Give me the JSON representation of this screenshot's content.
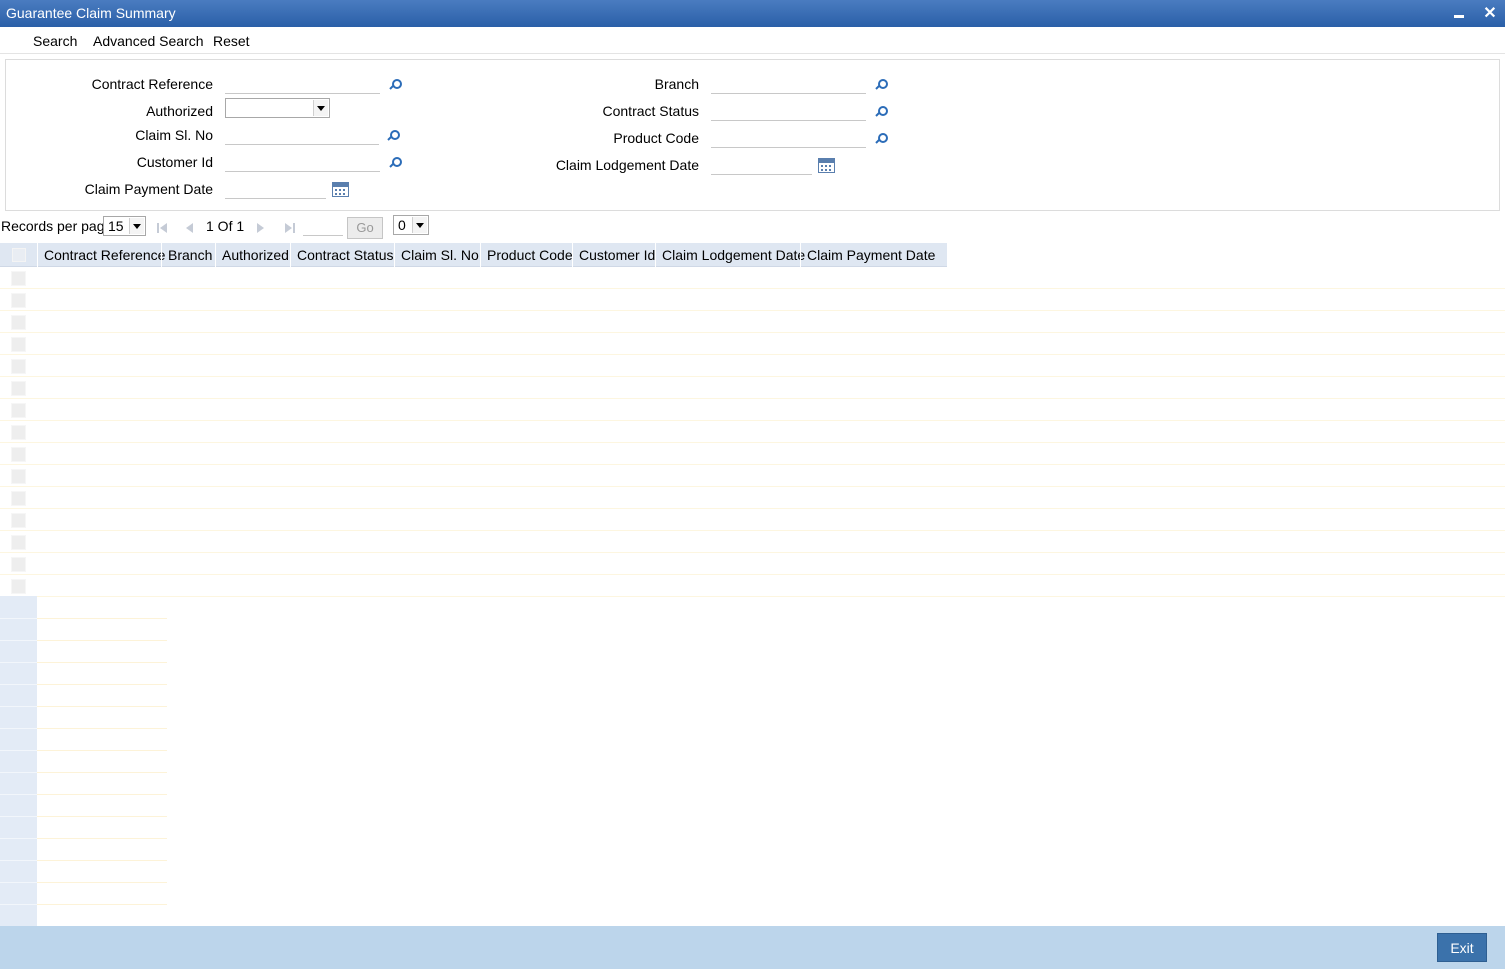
{
  "window": {
    "title": "Guarantee Claim Summary"
  },
  "toolbar": {
    "search": "Search",
    "advanced_search": "Advanced Search",
    "reset": "Reset"
  },
  "form": {
    "contract_reference": {
      "label": "Contract Reference",
      "value": ""
    },
    "authorized": {
      "label": "Authorized",
      "value": ""
    },
    "claim_sl_no": {
      "label": "Claim Sl. No",
      "value": ""
    },
    "customer_id": {
      "label": "Customer Id",
      "value": ""
    },
    "claim_payment_date": {
      "label": "Claim Payment Date",
      "value": ""
    },
    "branch": {
      "label": "Branch",
      "value": ""
    },
    "contract_status": {
      "label": "Contract Status",
      "value": ""
    },
    "product_code": {
      "label": "Product Code",
      "value": ""
    },
    "claim_lodgement_date": {
      "label": "Claim Lodgement Date",
      "value": ""
    }
  },
  "pager": {
    "records_label": "Records per page",
    "records_value": "15",
    "page_info": "1 Of 1",
    "go_label": "Go",
    "goto_value": "",
    "extra_select_value": "0"
  },
  "grid": {
    "columns": [
      "Contract Reference",
      "Branch",
      "Authorized",
      "Contract Status",
      "Claim Sl. No",
      "Product Code",
      "Customer Id",
      "Claim Lodgement Date",
      "Claim Payment Date"
    ],
    "row_count": 15
  },
  "footer": {
    "exit": "Exit"
  },
  "colors": {
    "titlebar": "#2a5fa8",
    "footer": "#bcd5eb",
    "exit_button": "#3b72ab",
    "grid_header": "#dfe7f2"
  }
}
